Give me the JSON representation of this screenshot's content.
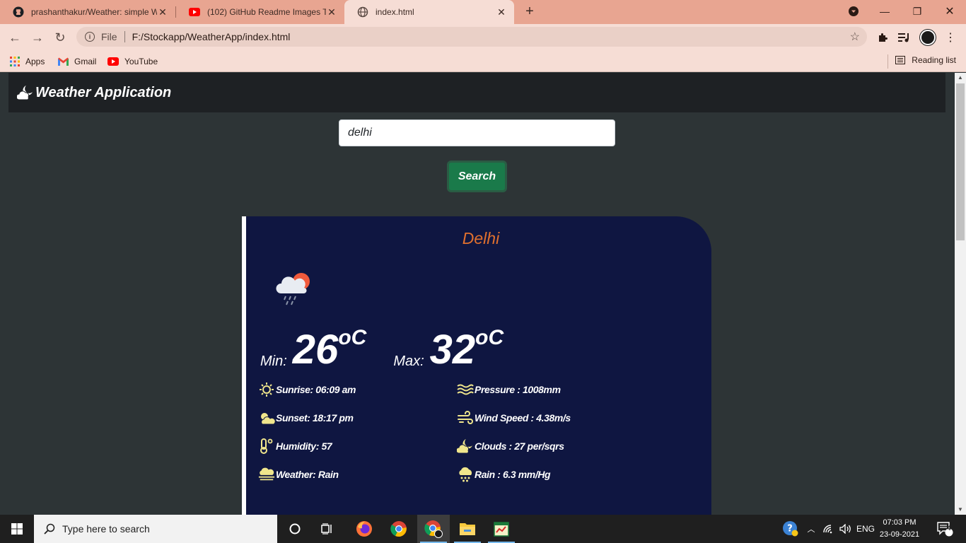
{
  "browser": {
    "tabs": [
      {
        "title": "prashanthakur/Weather: simple W",
        "icon": "github-icon"
      },
      {
        "title": "(102) GitHub Readme Images Tut",
        "icon": "youtube-icon"
      },
      {
        "title": "index.html",
        "icon": "globe-icon"
      }
    ],
    "address": {
      "scheme": "File",
      "url": "F:/Stockapp/WeatherApp/index.html"
    },
    "bookmarks": [
      {
        "label": "Apps",
        "icon": "apps-grid-icon"
      },
      {
        "label": "Gmail",
        "icon": "gmail-icon"
      },
      {
        "label": "YouTube",
        "icon": "youtube-icon"
      }
    ],
    "reading_list": "Reading list"
  },
  "app": {
    "brand": "Weather Application",
    "search_value": "delhi",
    "search_button": "Search",
    "accent": "#e0702e",
    "card_bg": "#0f1641"
  },
  "weather": {
    "city": "Delhi",
    "min_label": "Min:",
    "min_value": "26",
    "max_label": "Max:",
    "max_value": "32",
    "unit": "oC",
    "details_left": [
      {
        "text": "Sunrise: 06:09 am",
        "icon": "sun-icon"
      },
      {
        "text": "Sunset: 18:17 pm",
        "icon": "sunset-icon"
      },
      {
        "text": "Humidity: 57",
        "icon": "thermometer-icon"
      },
      {
        "text": "Weather: Rain",
        "icon": "fog-icon"
      }
    ],
    "details_right": [
      {
        "text": "Pressure : 1008mm",
        "icon": "pressure-icon"
      },
      {
        "text": "Wind Speed : 4.38m/s",
        "icon": "wind-icon"
      },
      {
        "text": "Clouds : 27 per/sqrs",
        "icon": "cloud-moon-icon"
      },
      {
        "text": "Rain : 6.3 mm/Hg",
        "icon": "rain-icon"
      }
    ]
  },
  "taskbar": {
    "search_placeholder": "Type here to search",
    "language": "ENG",
    "time": "07:03 PM",
    "date": "23-09-2021",
    "notifications": "4"
  }
}
